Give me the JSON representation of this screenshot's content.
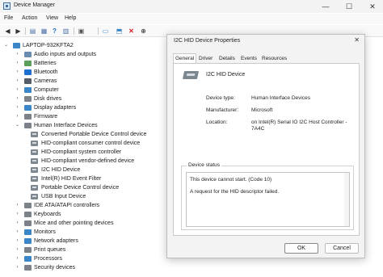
{
  "window": {
    "title": "Device Manager",
    "controls": [
      "—",
      "☐",
      "✕"
    ]
  },
  "menu": [
    "File",
    "Action",
    "View",
    "Help"
  ],
  "toolbar": {
    "buttons": [
      "back-icon",
      "forward-icon",
      "properties-icon",
      "help-icon",
      "scan-icon",
      "update-driver-icon",
      "disable-icon",
      "uninstall-icon",
      "enable-icon"
    ]
  },
  "tree": {
    "root": "LAPTOP-932KFTA2",
    "categories_before": [
      {
        "label": "Audio inputs and outputs",
        "icon_color": "#6a8caf"
      },
      {
        "label": "Batteries",
        "icon_color": "#5aa05a"
      },
      {
        "label": "Bluetooth",
        "icon_color": "#1f6fd0"
      },
      {
        "label": "Cameras",
        "icon_color": "#555d66"
      },
      {
        "label": "Computer",
        "icon_color": "#3a86c8"
      },
      {
        "label": "Disk drives",
        "icon_color": "#7b828a"
      },
      {
        "label": "Display adapters",
        "icon_color": "#3a86c8"
      },
      {
        "label": "Firmware",
        "icon_color": "#7b828a"
      }
    ],
    "expanded_category": "Human Interface Devices",
    "hid_children": [
      "Converted Portable Device Control device",
      "HID-compliant consumer control device",
      "HID-compliant system controller",
      "HID-compliant vendor-defined device",
      "I2C HID Device",
      "Intel(R) HID Event Filter",
      "Portable Device Control device",
      "USB Input Device"
    ],
    "categories_after": [
      {
        "label": "IDE ATA/ATAPI controllers",
        "icon_color": "#7b828a"
      },
      {
        "label": "Keyboards",
        "icon_color": "#7b828a"
      },
      {
        "label": "Mice and other pointing devices",
        "icon_color": "#7b828a"
      },
      {
        "label": "Monitors",
        "icon_color": "#3a86c8"
      },
      {
        "label": "Network adapters",
        "icon_color": "#3a86c8"
      },
      {
        "label": "Print queues",
        "icon_color": "#7b828a"
      },
      {
        "label": "Processors",
        "icon_color": "#3a86c8"
      },
      {
        "label": "Security devices",
        "icon_color": "#7b828a"
      }
    ]
  },
  "dialog": {
    "title": "I2C HID Device Properties",
    "close": "✕",
    "tabs": [
      "General",
      "Driver",
      "Details",
      "Events",
      "Resources"
    ],
    "active_tab": "General",
    "device_name": "I2C HID Device",
    "props": {
      "type_label": "Device type:",
      "type_value": "Human Interface Devices",
      "manufacturer_label": "Manufacturer:",
      "manufacturer_value": "Microsoft",
      "location_label": "Location:",
      "location_value": "on Intel(R) Serial IO I2C Host Controller - 7A4C"
    },
    "status": {
      "legend": "Device status",
      "line1": "This device cannot start. (Code 10)",
      "line2": "A request for the HID descriptor failed."
    },
    "buttons": {
      "ok": "OK",
      "cancel": "Cancel"
    }
  }
}
